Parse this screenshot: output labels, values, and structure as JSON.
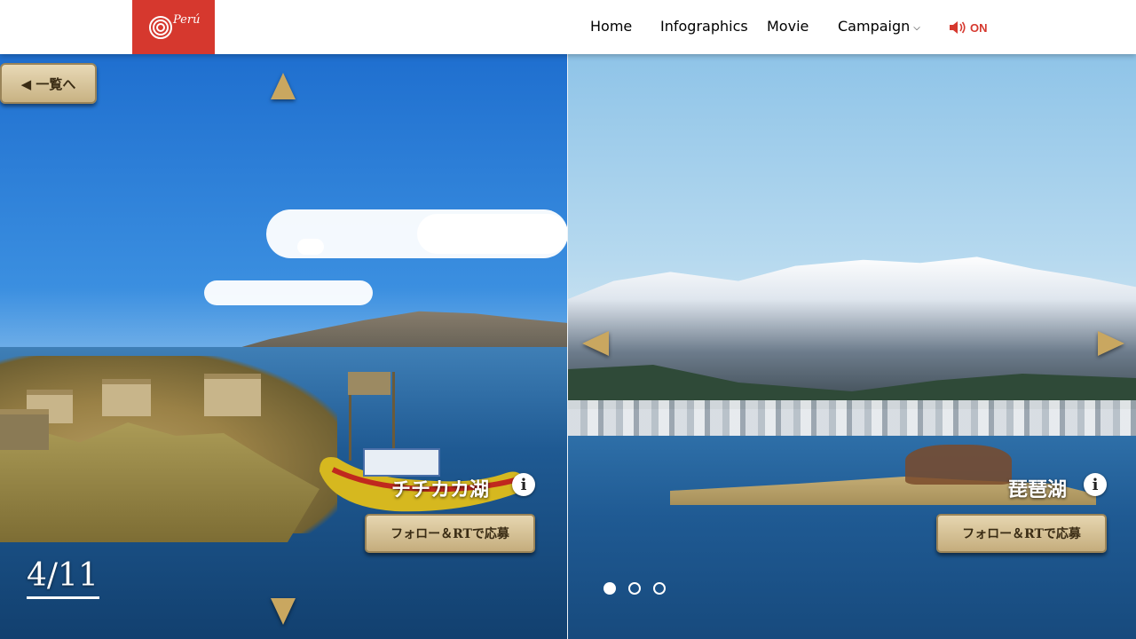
{
  "header": {
    "logo_text": "Perú",
    "nav": [
      {
        "label": "Home"
      },
      {
        "label": "Infographics"
      },
      {
        "label": "Movie"
      },
      {
        "label": "Campaign",
        "has_dropdown": true
      }
    ],
    "sound_label": "ON",
    "sound_icon": "speaker-icon",
    "accent_color": "#d6382e"
  },
  "viewer": {
    "back_label": "◀ 一覧へ",
    "counter": "4/11",
    "left_panel": {
      "title": "チチカカ湖",
      "follow_label": "フォロー＆RTで応募"
    },
    "right_panel": {
      "title": "琵琶湖",
      "follow_label": "フォロー＆RTで応募"
    },
    "slide_dots": [
      {
        "active": true
      },
      {
        "active": false
      },
      {
        "active": false
      }
    ]
  }
}
